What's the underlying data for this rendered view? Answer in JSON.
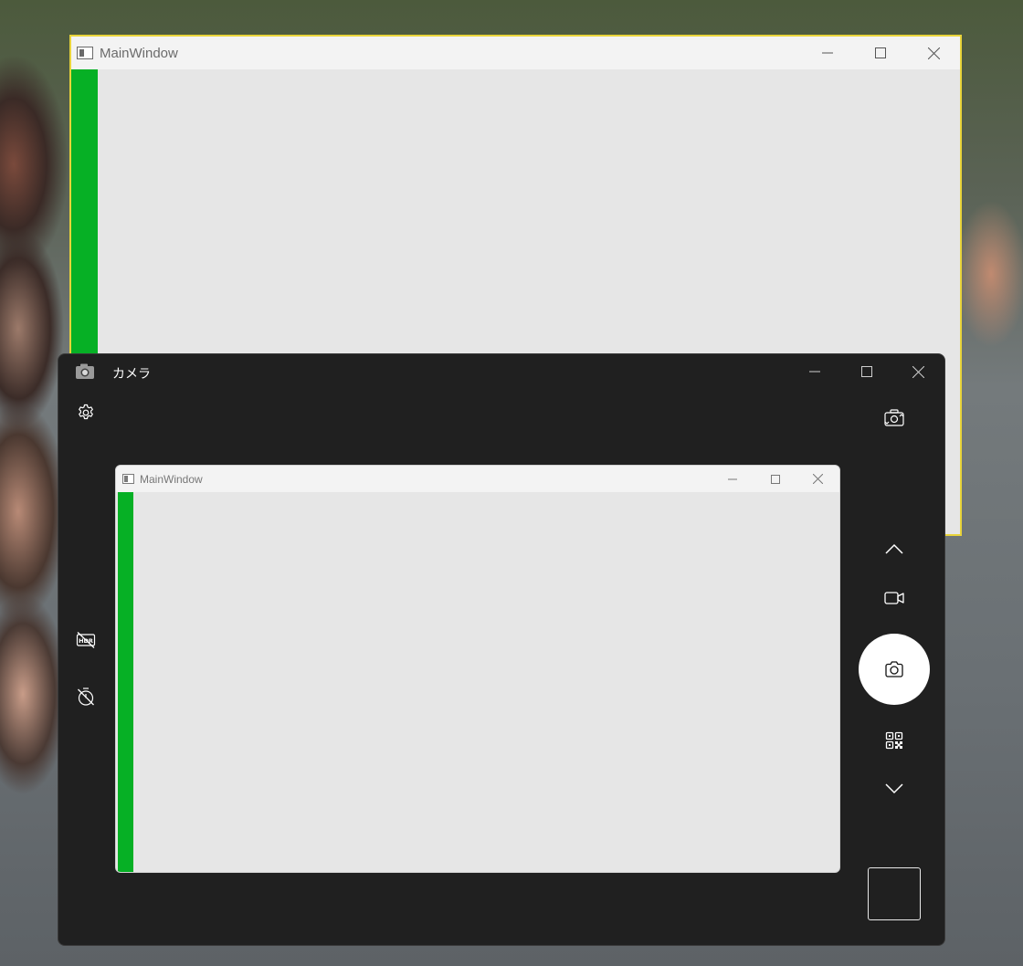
{
  "main_window": {
    "title": "MainWindow",
    "accent_border": "#e9d43a",
    "bar_color": "#06b025",
    "controls": [
      "minimize",
      "maximize",
      "close"
    ]
  },
  "camera": {
    "title": "カメラ",
    "left_tools": [
      "settings-icon",
      "hdr-off-icon",
      "timer-off-icon"
    ],
    "right_tools": [
      "switch-camera-icon",
      "chevron-up-icon",
      "video-mode-icon",
      "photo-shutter-icon",
      "qr-code-icon",
      "chevron-down-icon"
    ],
    "preview": {
      "title": "MainWindow"
    }
  }
}
